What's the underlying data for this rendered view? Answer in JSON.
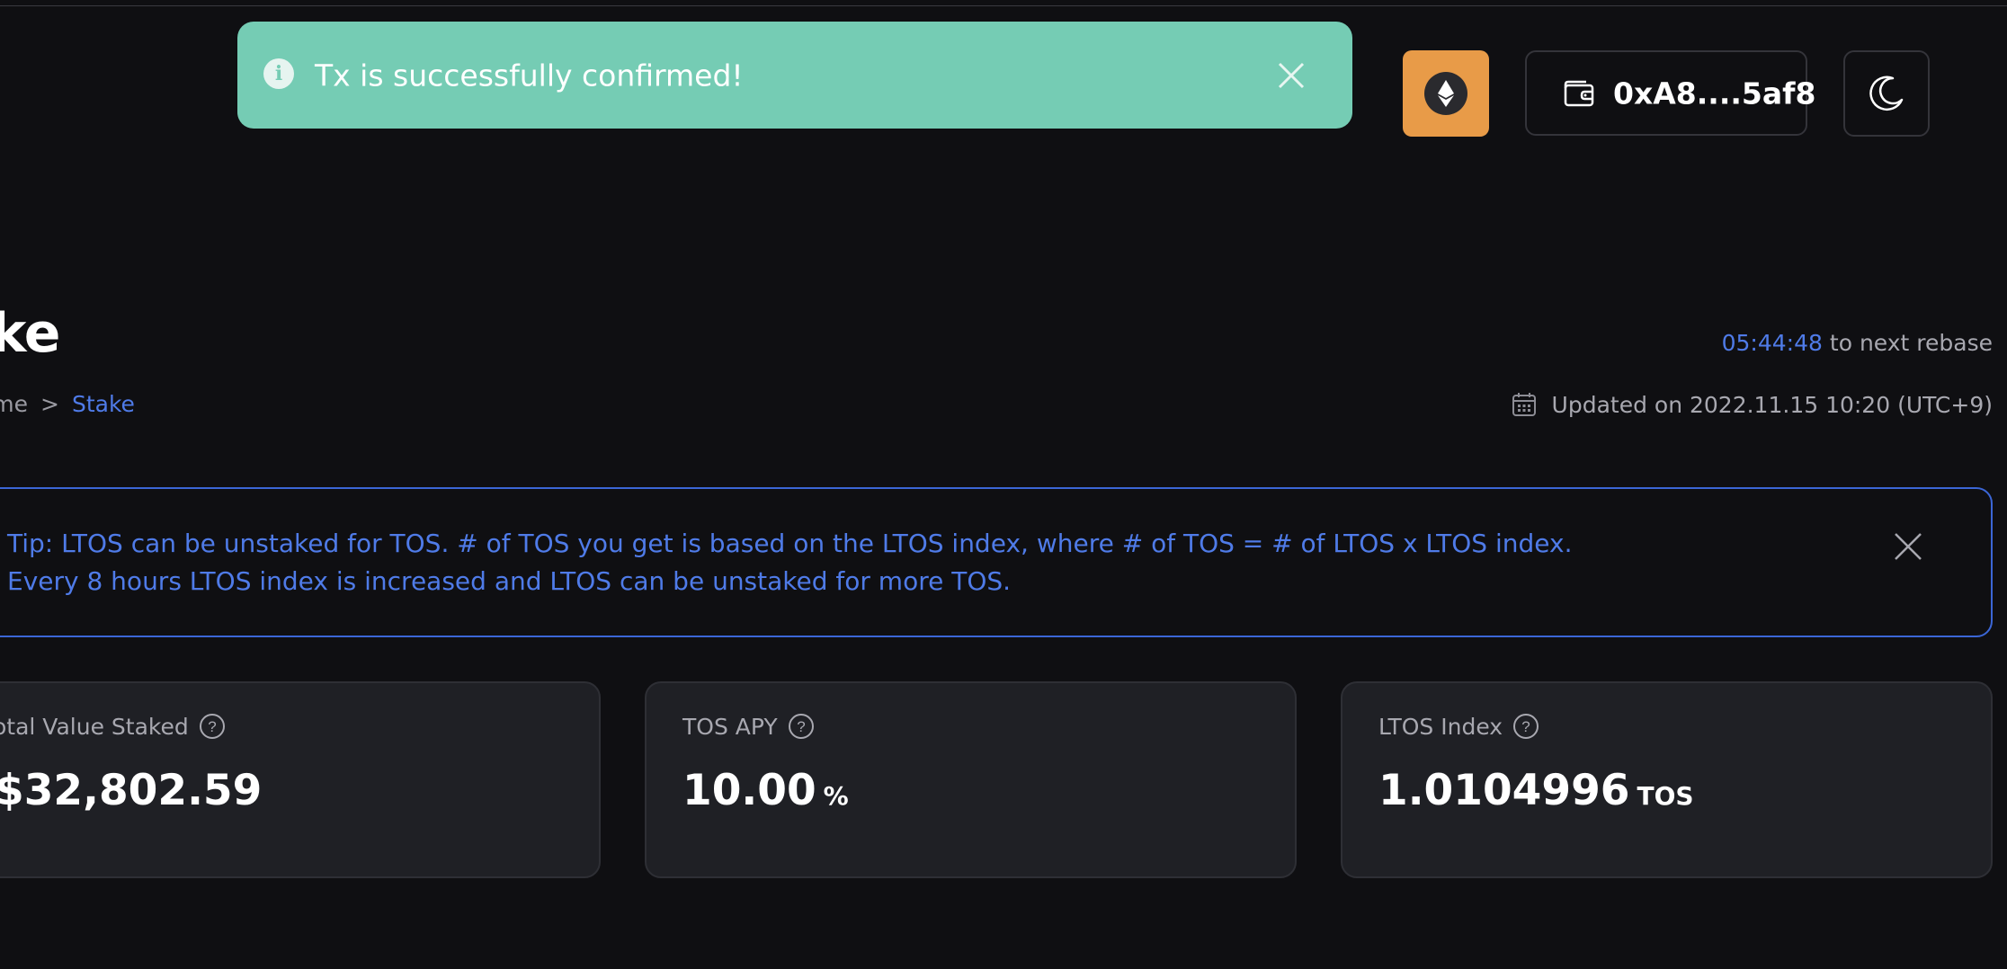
{
  "toast": {
    "message": "Tx is successfully confirmed!",
    "icon": "info-icon",
    "background": "#75ccb4"
  },
  "header": {
    "network_icon": "ethereum-icon",
    "network_color": "#e89b48",
    "wallet_icon": "wallet-icon",
    "wallet_address": "0xA8....5af8",
    "theme_icon": "moon-icon"
  },
  "page": {
    "title": "ake",
    "breadcrumb": {
      "home": "ome",
      "separator": ">",
      "current": "Stake"
    }
  },
  "rebase": {
    "timer": "05:44:48",
    "suffix": "to next rebase"
  },
  "updated": {
    "icon": "calendar-icon",
    "text": "Updated on 2022.11.15 10:20 (UTC+9)"
  },
  "tip": {
    "line1": "Tip: LTOS can be unstaked for TOS. # of TOS you get is based on the LTOS index, where # of TOS = # of LTOS x LTOS index.",
    "line2": "Every 8 hours LTOS index is increased and LTOS can be unstaked for more TOS.",
    "accent": "#4f7be8"
  },
  "stats": [
    {
      "label": "otal Value Staked",
      "value": "$32,802.59",
      "unit": ""
    },
    {
      "label": "TOS APY",
      "value": "10.00",
      "unit": "%"
    },
    {
      "label": "LTOS Index",
      "value": "1.0104996",
      "unit": "TOS"
    }
  ]
}
